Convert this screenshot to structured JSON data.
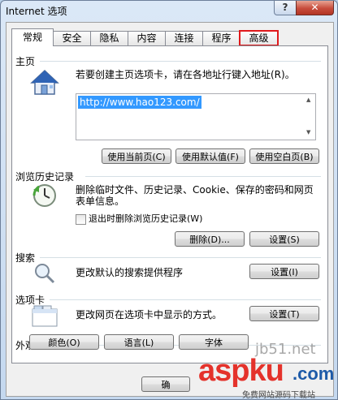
{
  "window": {
    "title": "Internet 选项",
    "help_label": "?",
    "close_label": "✕"
  },
  "tabs": [
    "常规",
    "安全",
    "隐私",
    "内容",
    "连接",
    "程序",
    "高级"
  ],
  "home": {
    "title": "主页",
    "desc": "若要创建主页选项卡，请在各地址行键入地址(R)。",
    "url": "http://www.hao123.com/",
    "btn_current": "使用当前页(C)",
    "btn_default": "使用默认值(F)",
    "btn_blank": "使用空白页(B)"
  },
  "history": {
    "title": "浏览历史记录",
    "desc_line1": "删除临时文件、历史记录、Cookie、保存的密码和网页",
    "desc_line2": "表单信息。",
    "checkbox_label": "退出时删除浏览历史记录(W)",
    "btn_delete": "删除(D)...",
    "btn_settings": "设置(S)"
  },
  "search": {
    "title": "搜索",
    "desc": "更改默认的搜索提供程序",
    "btn_settings": "设置(I)"
  },
  "tabs_section": {
    "title": "选项卡",
    "desc": "更改网页在选项卡中显示的方式。",
    "btn_settings": "设置(T)"
  },
  "appearance": {
    "title": "外观",
    "btn_colors": "颜色(O)",
    "btn_languages": "语言(L)",
    "btn_fonts": "字体"
  },
  "footer": {
    "btn_ok": "确"
  },
  "watermark": {
    "line1": "jb51.net",
    "logo": "aspku",
    "suffix": ".com",
    "tagline": "免费网站源码下载站"
  }
}
